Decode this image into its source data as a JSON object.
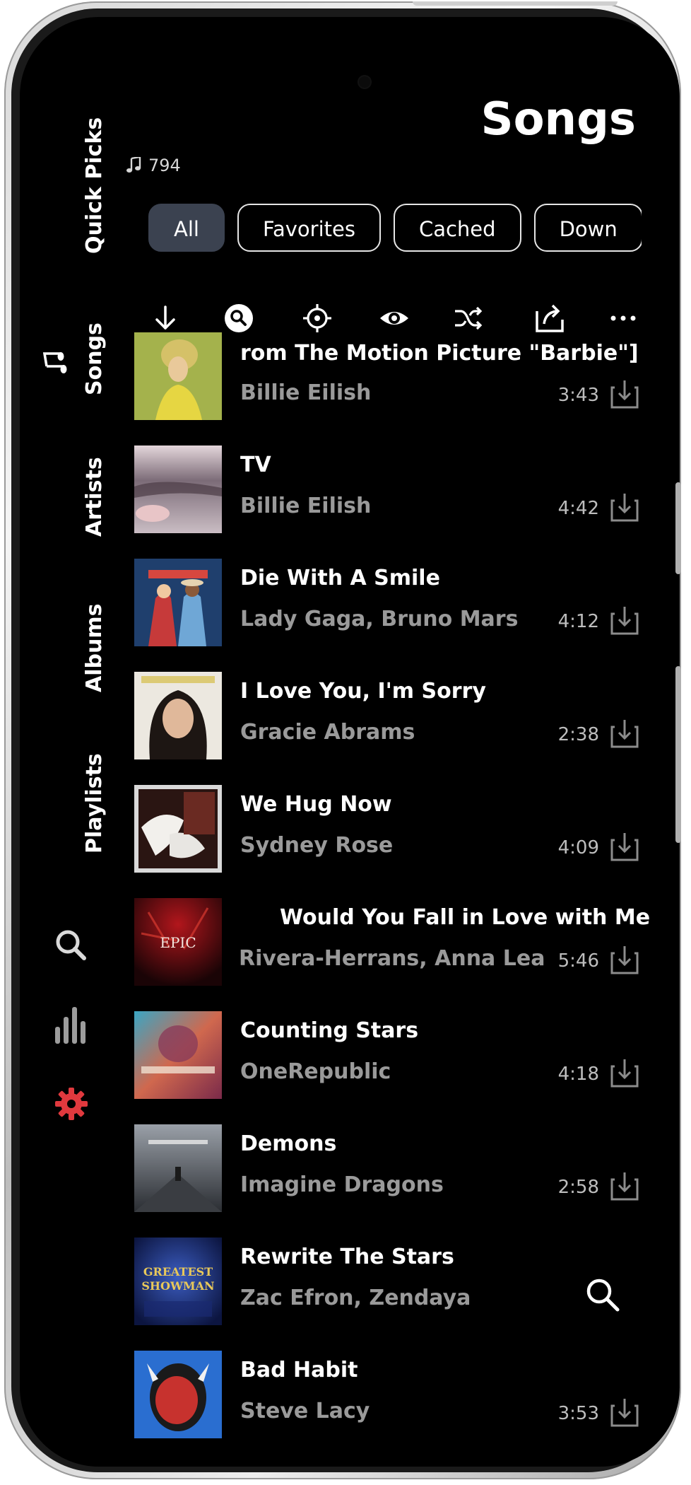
{
  "page_title": "Songs",
  "song_count": "794",
  "side_rail": {
    "items": [
      {
        "label": "Quick Picks"
      },
      {
        "label": "Songs"
      },
      {
        "label": "Artists"
      },
      {
        "label": "Albums"
      },
      {
        "label": "Playlists"
      }
    ],
    "icons": [
      "search-icon",
      "equalizer-icon",
      "settings-icon"
    ],
    "settings_color": "#e0393e"
  },
  "chips": [
    {
      "label": "All",
      "active": true
    },
    {
      "label": "Favorites"
    },
    {
      "label": "Cached"
    },
    {
      "label": "Down"
    }
  ],
  "toolbar": [
    "sort-descending-icon",
    "search-circle-icon",
    "locate-icon",
    "visibility-icon",
    "shuffle-icon",
    "import-icon",
    "more-horizontal-icon"
  ],
  "songs": [
    {
      "title": "rom The Motion Picture \"Barbie\"]",
      "artist": "Billie Eilish",
      "duration": "3:43",
      "cover_color": "#a4b24c"
    },
    {
      "title": "TV",
      "artist": "Billie Eilish",
      "duration": "4:42",
      "cover_color": "#a98e98"
    },
    {
      "title": "Die With A Smile",
      "artist": "Lady Gaga, Bruno Mars",
      "duration": "4:12",
      "cover_color": "#1f3f6d"
    },
    {
      "title": "I Love You, I'm Sorry",
      "artist": "Gracie Abrams",
      "duration": "2:38",
      "cover_color": "#e8e4dc"
    },
    {
      "title": "We Hug Now",
      "artist": "Sydney Rose",
      "duration": "4:09",
      "cover_color": "#4a2420"
    },
    {
      "title": "Would You Fall in Love with Me",
      "artist": "Rivera-Herrans, Anna Lea",
      "duration": "5:46",
      "cover_color": "#6a0c10"
    },
    {
      "title": "Counting Stars",
      "artist": "OneRepublic",
      "duration": "4:18",
      "cover_color": "#c05a4a"
    },
    {
      "title": "Demons",
      "artist": "Imagine Dragons",
      "duration": "2:58",
      "cover_color": "#5f646c"
    },
    {
      "title": "Rewrite The Stars",
      "artist": "Zac Efron, Zendaya",
      "duration": "",
      "cover_color": "#1b2c7a"
    },
    {
      "title": "Bad Habit",
      "artist": "Steve Lacy",
      "duration": "3:53",
      "cover_color": "#2a6ed0"
    }
  ]
}
